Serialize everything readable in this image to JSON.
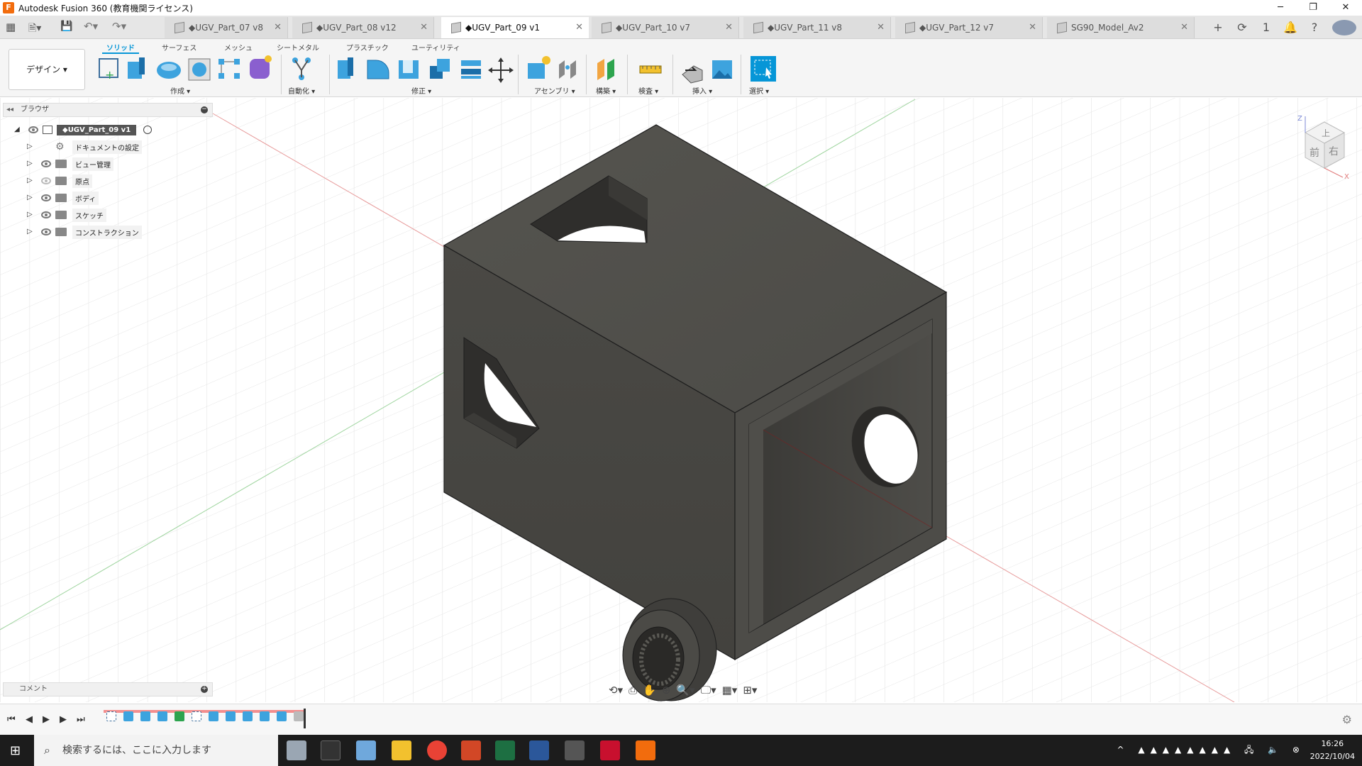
{
  "window": {
    "title": "Autodesk Fusion 360 (教育機関ライセンス)",
    "minimize": "─",
    "restore": "❐",
    "close": "✕"
  },
  "tabs": [
    {
      "label": "◆UGV_Part_07 v8"
    },
    {
      "label": "◆UGV_Part_08 v12"
    },
    {
      "label": "◆UGV_Part_09 v1",
      "active": true
    },
    {
      "label": "◆UGV_Part_10 v7"
    },
    {
      "label": "◆UGV_Part_11 v8"
    },
    {
      "label": "◆UGV_Part_12 v7"
    },
    {
      "label": "SG90_Model_Av2"
    }
  ],
  "tab_close": "✕",
  "tabbar_right": {
    "add": "+",
    "online": "⟳",
    "jobs": "1",
    "notify": "🔔",
    "help": "?"
  },
  "workspace": {
    "label": "デザイン ▾"
  },
  "ribbon_tabs": [
    "ソリッド",
    "サーフェス",
    "メッシュ",
    "シートメタル",
    "プラスチック",
    "ユーティリティ"
  ],
  "groups": {
    "create": "作成 ▾",
    "automate": "自動化 ▾",
    "modify": "修正 ▾",
    "assemble": "アセンブリ ▾",
    "construct": "構築 ▾",
    "inspect": "検査 ▾",
    "insert": "挿入 ▾",
    "select": "選択 ▾"
  },
  "browser": {
    "title": "ブラウザ",
    "root": "◆UGV_Part_09 v1",
    "items": [
      {
        "label": "ドキュメントの設定",
        "icon": "gear"
      },
      {
        "label": "ビュー管理",
        "icon": "folder"
      },
      {
        "label": "原点",
        "icon": "folder",
        "hidden": true
      },
      {
        "label": "ボディ",
        "icon": "folder"
      },
      {
        "label": "スケッチ",
        "icon": "folder"
      },
      {
        "label": "コンストラクション",
        "icon": "folder"
      }
    ]
  },
  "comments": {
    "label": "コメント"
  },
  "viewcube": {
    "top": "上",
    "front": "前",
    "right": "右",
    "z": "Z",
    "x": "X"
  },
  "taskbar": {
    "search_placeholder": "検索するには、ここに入力します",
    "time": "16:26",
    "date": "2022/10/04"
  },
  "colors": {
    "accent": "#0696d7",
    "fusion_orange": "#f26c0d",
    "model_body": "#4a4945"
  }
}
